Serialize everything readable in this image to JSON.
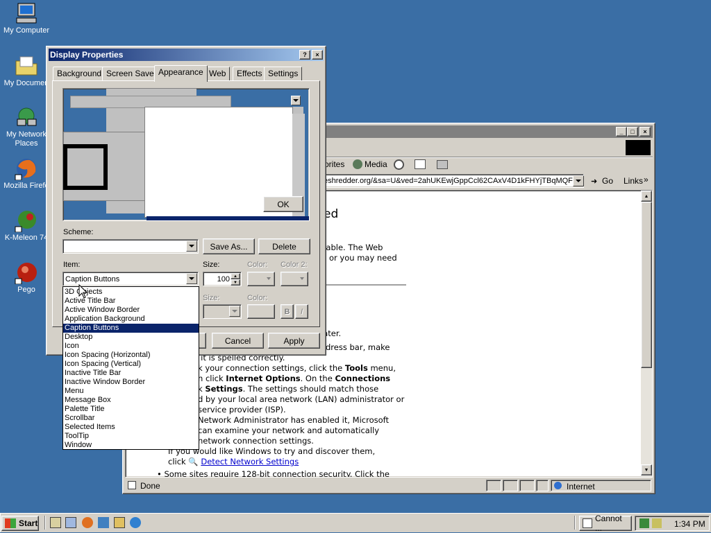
{
  "desktop": {
    "icons": [
      {
        "label": "My Computer"
      },
      {
        "label": "My Documen"
      },
      {
        "label": "My Network Places"
      },
      {
        "label": "Mozilla Firefo"
      },
      {
        "label": "K-Meleon 74"
      },
      {
        "label": "Pego"
      }
    ]
  },
  "ie": {
    "toolbar_favorites": "orites",
    "toolbar_media": "Media",
    "address": "eshredder.org/&sa=U&ved=2ahUKEwjGppCcl62CAxV4D1kFHYjTBqMQFnc",
    "go_label": "Go",
    "links_label": "Links",
    "status_text": "Done",
    "zone_text": "Internet",
    "content": {
      "heading": "ved",
      "line1": "ailable. The Web",
      "line2": "or you may need",
      "line3": "later.",
      "line4": "dress bar, make",
      "line5": "t it is spelled correctly.",
      "line6a": "k your connection settings, click the ",
      "line6b": "Tools",
      "line6c": " menu,",
      "line7a": "n click ",
      "line7b": "Internet Options",
      "line7c": ". On the ",
      "line7d": "Connections",
      "line8a": "k ",
      "line8b": "Settings",
      "line8c": ". The settings should match those",
      "line9": "d by your local area network (LAN) administrator or",
      "line10": " service provider (ISP).",
      "line11": "Network Administrator has enabled it, Microsoft",
      "line12": " can examine your network and automatically",
      "line13": " network connection settings.",
      "line14": "If you would like Windows to try and discover them,",
      "line15a": "click ",
      "line15b": "Detect Network Settings",
      "line16": "Some sites require 128-bit connection security. Click the"
    }
  },
  "dialog": {
    "title": "Display Properties",
    "tabs": [
      "Background",
      "Screen Saver",
      "Appearance",
      "Web",
      "Effects",
      "Settings"
    ],
    "preview_ok": "OK",
    "scheme_label": "Scheme:",
    "scheme_value": "",
    "save_as": "Save As...",
    "delete": "Delete",
    "item_label": "Item:",
    "item_value": "Caption Buttons",
    "size_label": "Size:",
    "size_value": "100",
    "color_label": "Color:",
    "color2_label": "Color 2:",
    "font_size_label": "Size:",
    "font_color_label": "Color:",
    "bold": "B",
    "italic": "I",
    "cancel": "Cancel",
    "apply": "Apply",
    "item_options": [
      "3D Objects",
      "Active Title Bar",
      "Active Window Border",
      "Application Background",
      "Caption Buttons",
      "Desktop",
      "Icon",
      "Icon Spacing (Horizontal)",
      "Icon Spacing (Vertical)",
      "Inactive Title Bar",
      "Inactive Window Border",
      "Menu",
      "Message Box",
      "Palette Title",
      "Scrollbar",
      "Selected Items",
      "ToolTip",
      "Window"
    ],
    "selected_index": 4
  },
  "taskbar": {
    "start": "Start",
    "task_label": "Cannot ...",
    "clock": "1:34 PM"
  },
  "colors": {
    "desktop": "#3a6ea5",
    "titlebar": "#0a246a",
    "face": "#d4d0c8"
  }
}
